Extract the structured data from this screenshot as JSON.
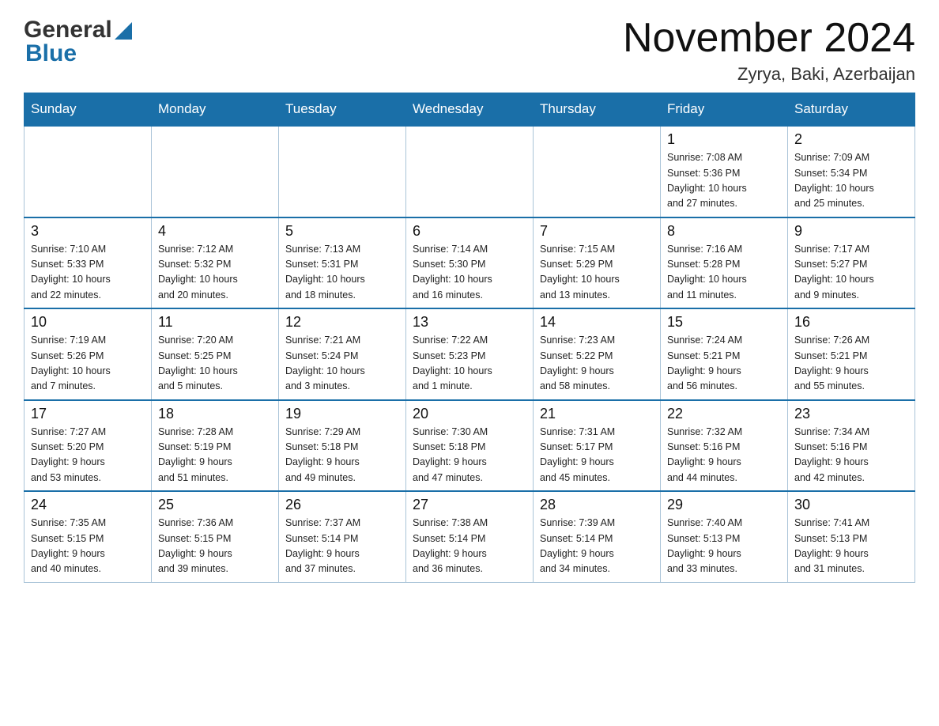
{
  "header": {
    "title": "November 2024",
    "location": "Zyrya, Baki, Azerbaijan"
  },
  "weekdays": [
    "Sunday",
    "Monday",
    "Tuesday",
    "Wednesday",
    "Thursday",
    "Friday",
    "Saturday"
  ],
  "weeks": [
    [
      {
        "day": "",
        "info": ""
      },
      {
        "day": "",
        "info": ""
      },
      {
        "day": "",
        "info": ""
      },
      {
        "day": "",
        "info": ""
      },
      {
        "day": "",
        "info": ""
      },
      {
        "day": "1",
        "info": "Sunrise: 7:08 AM\nSunset: 5:36 PM\nDaylight: 10 hours\nand 27 minutes."
      },
      {
        "day": "2",
        "info": "Sunrise: 7:09 AM\nSunset: 5:34 PM\nDaylight: 10 hours\nand 25 minutes."
      }
    ],
    [
      {
        "day": "3",
        "info": "Sunrise: 7:10 AM\nSunset: 5:33 PM\nDaylight: 10 hours\nand 22 minutes."
      },
      {
        "day": "4",
        "info": "Sunrise: 7:12 AM\nSunset: 5:32 PM\nDaylight: 10 hours\nand 20 minutes."
      },
      {
        "day": "5",
        "info": "Sunrise: 7:13 AM\nSunset: 5:31 PM\nDaylight: 10 hours\nand 18 minutes."
      },
      {
        "day": "6",
        "info": "Sunrise: 7:14 AM\nSunset: 5:30 PM\nDaylight: 10 hours\nand 16 minutes."
      },
      {
        "day": "7",
        "info": "Sunrise: 7:15 AM\nSunset: 5:29 PM\nDaylight: 10 hours\nand 13 minutes."
      },
      {
        "day": "8",
        "info": "Sunrise: 7:16 AM\nSunset: 5:28 PM\nDaylight: 10 hours\nand 11 minutes."
      },
      {
        "day": "9",
        "info": "Sunrise: 7:17 AM\nSunset: 5:27 PM\nDaylight: 10 hours\nand 9 minutes."
      }
    ],
    [
      {
        "day": "10",
        "info": "Sunrise: 7:19 AM\nSunset: 5:26 PM\nDaylight: 10 hours\nand 7 minutes."
      },
      {
        "day": "11",
        "info": "Sunrise: 7:20 AM\nSunset: 5:25 PM\nDaylight: 10 hours\nand 5 minutes."
      },
      {
        "day": "12",
        "info": "Sunrise: 7:21 AM\nSunset: 5:24 PM\nDaylight: 10 hours\nand 3 minutes."
      },
      {
        "day": "13",
        "info": "Sunrise: 7:22 AM\nSunset: 5:23 PM\nDaylight: 10 hours\nand 1 minute."
      },
      {
        "day": "14",
        "info": "Sunrise: 7:23 AM\nSunset: 5:22 PM\nDaylight: 9 hours\nand 58 minutes."
      },
      {
        "day": "15",
        "info": "Sunrise: 7:24 AM\nSunset: 5:21 PM\nDaylight: 9 hours\nand 56 minutes."
      },
      {
        "day": "16",
        "info": "Sunrise: 7:26 AM\nSunset: 5:21 PM\nDaylight: 9 hours\nand 55 minutes."
      }
    ],
    [
      {
        "day": "17",
        "info": "Sunrise: 7:27 AM\nSunset: 5:20 PM\nDaylight: 9 hours\nand 53 minutes."
      },
      {
        "day": "18",
        "info": "Sunrise: 7:28 AM\nSunset: 5:19 PM\nDaylight: 9 hours\nand 51 minutes."
      },
      {
        "day": "19",
        "info": "Sunrise: 7:29 AM\nSunset: 5:18 PM\nDaylight: 9 hours\nand 49 minutes."
      },
      {
        "day": "20",
        "info": "Sunrise: 7:30 AM\nSunset: 5:18 PM\nDaylight: 9 hours\nand 47 minutes."
      },
      {
        "day": "21",
        "info": "Sunrise: 7:31 AM\nSunset: 5:17 PM\nDaylight: 9 hours\nand 45 minutes."
      },
      {
        "day": "22",
        "info": "Sunrise: 7:32 AM\nSunset: 5:16 PM\nDaylight: 9 hours\nand 44 minutes."
      },
      {
        "day": "23",
        "info": "Sunrise: 7:34 AM\nSunset: 5:16 PM\nDaylight: 9 hours\nand 42 minutes."
      }
    ],
    [
      {
        "day": "24",
        "info": "Sunrise: 7:35 AM\nSunset: 5:15 PM\nDaylight: 9 hours\nand 40 minutes."
      },
      {
        "day": "25",
        "info": "Sunrise: 7:36 AM\nSunset: 5:15 PM\nDaylight: 9 hours\nand 39 minutes."
      },
      {
        "day": "26",
        "info": "Sunrise: 7:37 AM\nSunset: 5:14 PM\nDaylight: 9 hours\nand 37 minutes."
      },
      {
        "day": "27",
        "info": "Sunrise: 7:38 AM\nSunset: 5:14 PM\nDaylight: 9 hours\nand 36 minutes."
      },
      {
        "day": "28",
        "info": "Sunrise: 7:39 AM\nSunset: 5:14 PM\nDaylight: 9 hours\nand 34 minutes."
      },
      {
        "day": "29",
        "info": "Sunrise: 7:40 AM\nSunset: 5:13 PM\nDaylight: 9 hours\nand 33 minutes."
      },
      {
        "day": "30",
        "info": "Sunrise: 7:41 AM\nSunset: 5:13 PM\nDaylight: 9 hours\nand 31 minutes."
      }
    ]
  ]
}
